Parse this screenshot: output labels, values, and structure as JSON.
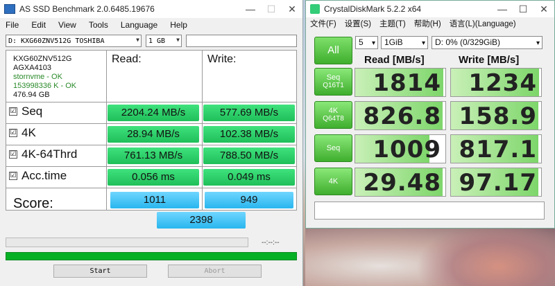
{
  "asssd": {
    "title": "AS SSD Benchmark 2.0.6485.19676",
    "controls": {
      "minimize": "—",
      "maximize": "☐",
      "close": "✕"
    },
    "menu": [
      "File",
      "Edit",
      "View",
      "Tools",
      "Language",
      "Help"
    ],
    "drive_select": "D: KXG60ZNV512G TOSHIBA",
    "size_select": "1 GB",
    "info": {
      "model": "KXG60ZNV512G",
      "firmware": "AGXA4103",
      "driver": "stornvme - OK",
      "alignment": "153998336 K - OK",
      "capacity": "476.94 GB"
    },
    "headers": {
      "read": "Read:",
      "write": "Write:"
    },
    "rows": [
      {
        "label": "Seq",
        "read": "2204.24 MB/s",
        "write": "577.69 MB/s"
      },
      {
        "label": "4K",
        "read": "28.94 MB/s",
        "write": "102.38 MB/s"
      },
      {
        "label": "4K-64Thrd",
        "read": "761.13 MB/s",
        "write": "788.50 MB/s"
      },
      {
        "label": "Acc.time",
        "read": "0.056 ms",
        "write": "0.049 ms"
      }
    ],
    "check_mark": "☑",
    "score_label": "Score:",
    "score": {
      "read": "1011",
      "write": "949",
      "total": "2398"
    },
    "progress_time": "--:--:--",
    "progress_fraction": 1.0,
    "buttons": {
      "start": "Start",
      "abort": "Abort"
    }
  },
  "cdm": {
    "title": "CrystalDiskMark 5.2.2 x64",
    "controls": {
      "minimize": "—",
      "maximize": "☐",
      "close": "✕"
    },
    "menu": [
      "文件(F)",
      "设置(S)",
      "主题(T)",
      "帮助(H)",
      "语言(L)(Language)"
    ],
    "all_label": "All",
    "count_select": "5",
    "size_select": "1GiB",
    "drive_select": "D: 0% (0/329GiB)",
    "headers": {
      "read": "Read [MB/s]",
      "write": "Write [MB/s]"
    },
    "tests": [
      {
        "label": "Seq",
        "sub": "Q16T1",
        "read": "1814",
        "write": "1234",
        "read_fill": 0.98,
        "write_fill": 0.98
      },
      {
        "label": "4K",
        "sub": "Q64T8",
        "read": "826.8",
        "write": "158.9",
        "read_fill": 0.97,
        "write_fill": 0.97
      },
      {
        "label": "Seq",
        "sub": "",
        "read": "1009",
        "write": "817.1",
        "read_fill": 0.82,
        "write_fill": 0.97
      },
      {
        "label": "4K",
        "sub": "",
        "read": "29.48",
        "write": "97.17",
        "read_fill": 0.97,
        "write_fill": 0.97
      }
    ],
    "colors": {
      "accent_green": "#3fae2e",
      "bar_green": "#7dd66a"
    }
  }
}
